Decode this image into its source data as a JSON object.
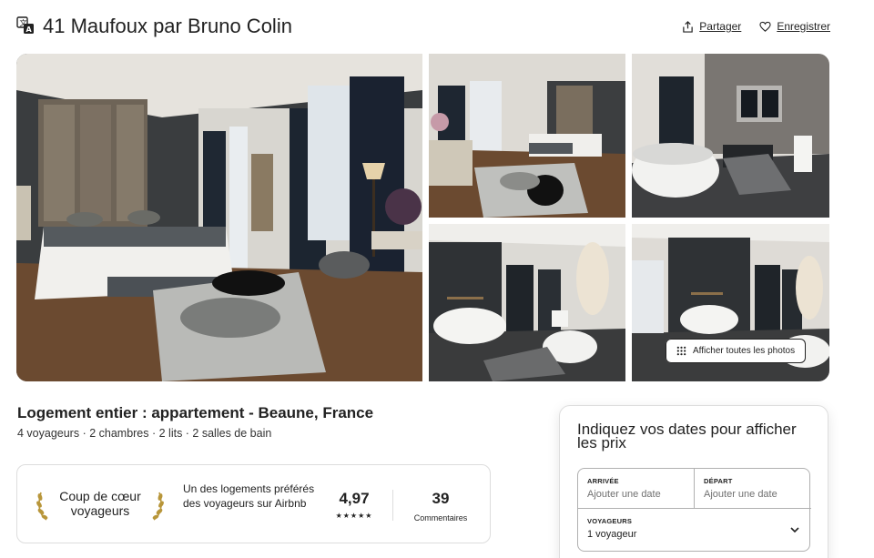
{
  "header": {
    "title": "41 Maufoux par Bruno Colin",
    "share_label": "Partager",
    "save_label": "Enregistrer"
  },
  "gallery": {
    "show_all_label": "Afficher toutes les photos"
  },
  "listing": {
    "title": "Logement entier : appartement - Beaune, France",
    "subtitle": "4 voyageurs · 2 chambres · 2 lits · 2 salles de bain"
  },
  "guest_favorite": {
    "label": "Coup de cœur voyageurs",
    "description": "Un des logements préférés des voyageurs sur Airbnb",
    "rating": "4,97",
    "stars": "★★★★★",
    "reviews_count": "39",
    "reviews_label": "Commentaires"
  },
  "booking": {
    "title": "Indiquez vos dates pour afficher les prix",
    "arrival_label": "ARRIVÉE",
    "arrival_placeholder": "Ajouter une date",
    "departure_label": "DÉPART",
    "departure_placeholder": "Ajouter une date",
    "guests_label": "VOYAGEURS",
    "guests_value": "1 voyageur"
  },
  "icons": {
    "translate": "translate-icon",
    "share": "share-icon",
    "heart": "heart-icon",
    "grid": "grid-dots-icon",
    "laurel": "laurel-icon",
    "chevron": "chevron-down-icon"
  },
  "colors": {
    "text": "#222222",
    "muted": "#717171",
    "border": "#dddddd",
    "laurel_gold": "#b8963a"
  }
}
